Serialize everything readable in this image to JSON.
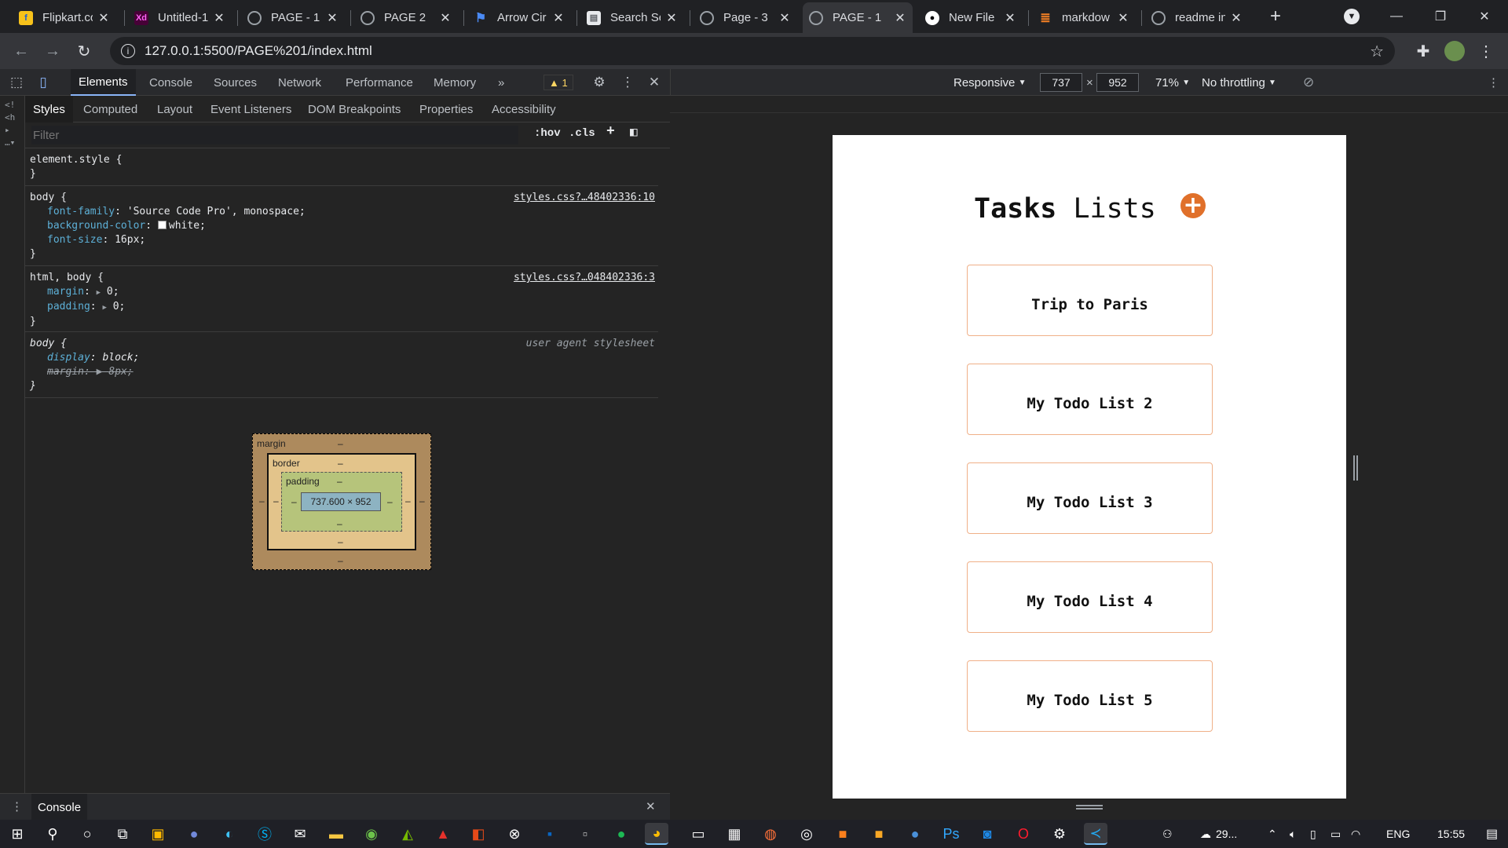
{
  "browser": {
    "tabs": [
      {
        "title": "Flipkart.co",
        "favicon_color": "#f7c21b",
        "favicon_glyph": "f",
        "active": false
      },
      {
        "title": "Untitled-1",
        "favicon_color": "#470137",
        "favicon_glyph": "Xd",
        "active": false
      },
      {
        "title": "PAGE - 1",
        "favicon_color": "#5f6368",
        "favicon_glyph": "globe",
        "active": false
      },
      {
        "title": "PAGE 2",
        "favicon_color": "#5f6368",
        "favicon_glyph": "globe",
        "active": false
      },
      {
        "title": "Arrow Cir",
        "favicon_color": "#1a73e8",
        "favicon_glyph": "flag",
        "active": false
      },
      {
        "title": "Search Se",
        "favicon_color": "#e8eaed",
        "favicon_glyph": "doc",
        "active": false
      },
      {
        "title": "Page - 3",
        "favicon_color": "#5f6368",
        "favicon_glyph": "globe",
        "active": false
      },
      {
        "title": "PAGE - 1",
        "favicon_color": "#5f6368",
        "favicon_glyph": "globe",
        "active": true
      },
      {
        "title": "New File",
        "favicon_color": "#ffffff",
        "favicon_glyph": "github",
        "active": false
      },
      {
        "title": "markdow",
        "favicon_color": "#f48024",
        "favicon_glyph": "stack",
        "active": false
      },
      {
        "title": "readme in",
        "favicon_color": "#5f6368",
        "favicon_glyph": "globe",
        "active": false
      }
    ],
    "new_tab_label": "+",
    "url": "127.0.0.1:5500/PAGE%201/index.html"
  },
  "devtools": {
    "main_tabs": [
      "Elements",
      "Console",
      "Sources",
      "Network",
      "Performance",
      "Memory"
    ],
    "more_tabs": "»",
    "warning_count": "1",
    "sub_tabs": [
      "Styles",
      "Computed",
      "Layout",
      "Event Listeners",
      "DOM Breakpoints",
      "Properties",
      "Accessibility"
    ],
    "filter_placeholder": "Filter",
    "hov_label": ":hov",
    "cls_label": ".cls",
    "rules": {
      "element_style": {
        "selector": "element.style {",
        "close": "}"
      },
      "body": {
        "selector": "body {",
        "source": "styles.css?…48402336:10",
        "font_family_prop": "font-family",
        "font_family_val": "'Source Code Pro', monospace;",
        "bg_prop": "background-color",
        "bg_val": "white;",
        "font_size_prop": "font-size",
        "font_size_val": "16px;",
        "close": "}"
      },
      "html_body": {
        "selector": "html, body {",
        "source": "styles.css?…048402336:3",
        "margin_prop": "margin",
        "margin_val": "0;",
        "padding_prop": "padding",
        "padding_val": "0;",
        "close": "}"
      },
      "ua_body": {
        "selector": "body {",
        "source": "user agent stylesheet",
        "display_prop": "display",
        "display_val": "block;",
        "margin_prop": "margin",
        "margin_val": "8px;",
        "close": "}"
      }
    },
    "box_model": {
      "margin_label": "margin",
      "border_label": "border",
      "padding_label": "padding",
      "content_size": "737.600 × 952",
      "dash": "–"
    },
    "console_label": "Console"
  },
  "device_toolbar": {
    "mode": "Responsive",
    "width": "737",
    "height": "952",
    "times": "×",
    "zoom": "71%",
    "throttling": "No throttling"
  },
  "page": {
    "title_bold": "Tasks",
    "title_light": "Lists",
    "add_icon": "+",
    "tasks": [
      "Trip to Paris",
      "My Todo List 2",
      "My Todo List 3",
      "My Todo List 4",
      "My Todo List 5"
    ]
  },
  "taskbar": {
    "weather": "29...",
    "language": "ENG",
    "time": "15:55"
  },
  "colors": {
    "accent_orange": "#e0702a",
    "card_border": "#f0b088",
    "devtools_active_tab": "#8ab4f8"
  }
}
